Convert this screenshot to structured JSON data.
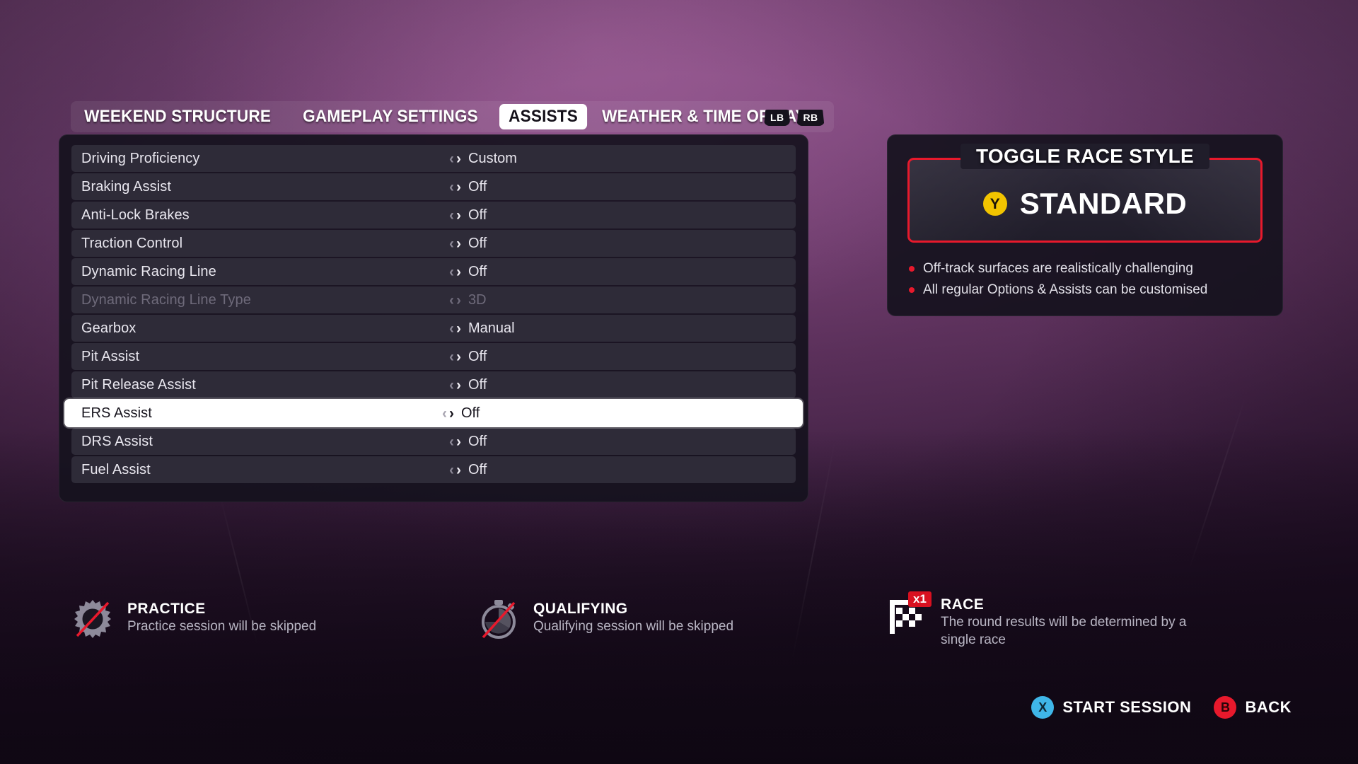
{
  "tabs": [
    {
      "label": "WEEKEND STRUCTURE",
      "active": false
    },
    {
      "label": "GAMEPLAY SETTINGS",
      "active": false
    },
    {
      "label": "ASSISTS",
      "active": true
    },
    {
      "label": "WEATHER & TIME OF DAY",
      "active": false
    }
  ],
  "shoulder_buttons": [
    {
      "label": "LB"
    },
    {
      "label": "RB"
    }
  ],
  "settings": {
    "rows": [
      {
        "label": "Driving Proficiency",
        "value": "Custom",
        "selected": false,
        "disabled": false
      },
      {
        "label": "Braking Assist",
        "value": "Off",
        "selected": false,
        "disabled": false
      },
      {
        "label": "Anti-Lock Brakes",
        "value": "Off",
        "selected": false,
        "disabled": false
      },
      {
        "label": "Traction Control",
        "value": "Off",
        "selected": false,
        "disabled": false
      },
      {
        "label": "Dynamic Racing Line",
        "value": "Off",
        "selected": false,
        "disabled": false
      },
      {
        "label": "Dynamic Racing Line Type",
        "value": "3D",
        "selected": false,
        "disabled": true
      },
      {
        "label": "Gearbox",
        "value": "Manual",
        "selected": false,
        "disabled": false
      },
      {
        "label": "Pit Assist",
        "value": "Off",
        "selected": false,
        "disabled": false
      },
      {
        "label": "Pit Release Assist",
        "value": "Off",
        "selected": false,
        "disabled": false
      },
      {
        "label": "ERS Assist",
        "value": "Off",
        "selected": true,
        "disabled": false
      },
      {
        "label": "DRS Assist",
        "value": "Off",
        "selected": false,
        "disabled": false
      },
      {
        "label": "Fuel Assist",
        "value": "Off",
        "selected": false,
        "disabled": false
      }
    ],
    "arrow_left": "‹",
    "arrow_right": "›"
  },
  "info_panel": {
    "title": "TOGGLE RACE STYLE",
    "button_glyph": "Y",
    "value": "STANDARD",
    "bullets": [
      "Off-track surfaces are realistically challenging",
      "All regular Options & Assists can be customised"
    ],
    "accent_color": "#e8192c",
    "button_color": "#f2c400"
  },
  "sessions": [
    {
      "title": "PRACTICE",
      "description": "Practice session will be skipped",
      "icon": "gear-skipped-icon",
      "skipped": true
    },
    {
      "title": "QUALIFYING",
      "description": "Qualifying session will be skipped",
      "icon": "stopwatch-skipped-icon",
      "skipped": true
    },
    {
      "title": "RACE",
      "description": "The round results will be determined by a single race",
      "icon": "checkered-flag-icon",
      "badge": "x1",
      "skipped": false
    }
  ],
  "prompts": [
    {
      "glyph": "X",
      "label": "START SESSION",
      "color": "#3fb6e8"
    },
    {
      "glyph": "B",
      "label": "BACK",
      "color": "#e8192c"
    }
  ]
}
